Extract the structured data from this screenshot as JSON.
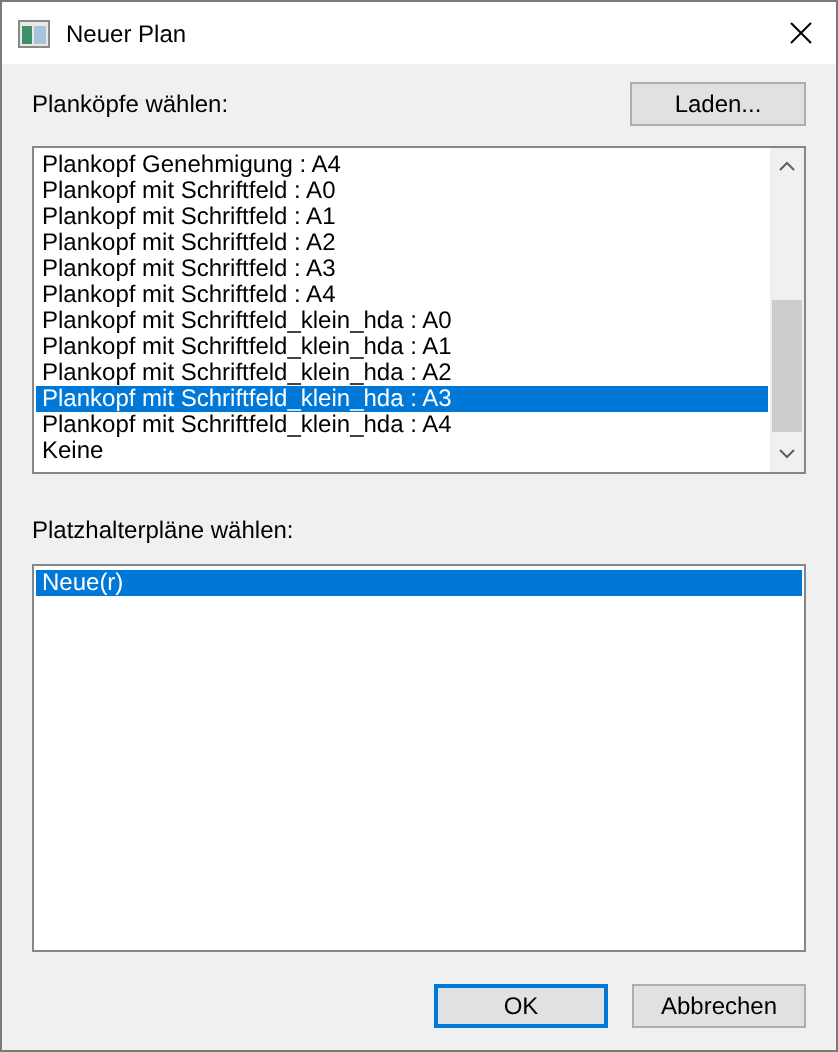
{
  "window": {
    "title": "Neuer Plan"
  },
  "plankoepfe": {
    "label": "Planköpfe wählen:",
    "load_button": "Laden...",
    "items": [
      {
        "text": "Plankopf Genehmigung : A4",
        "selected": false
      },
      {
        "text": "Plankopf mit Schriftfeld : A0",
        "selected": false
      },
      {
        "text": "Plankopf mit Schriftfeld : A1",
        "selected": false
      },
      {
        "text": "Plankopf mit Schriftfeld : A2",
        "selected": false
      },
      {
        "text": "Plankopf mit Schriftfeld : A3",
        "selected": false
      },
      {
        "text": "Plankopf mit Schriftfeld : A4",
        "selected": false
      },
      {
        "text": "Plankopf mit Schriftfeld_klein_hda : A0",
        "selected": false
      },
      {
        "text": "Plankopf mit Schriftfeld_klein_hda : A1",
        "selected": false
      },
      {
        "text": "Plankopf mit Schriftfeld_klein_hda : A2",
        "selected": false
      },
      {
        "text": "Plankopf mit Schriftfeld_klein_hda : A3",
        "selected": true
      },
      {
        "text": "Plankopf mit Schriftfeld_klein_hda : A4",
        "selected": false
      },
      {
        "text": "Keine",
        "selected": false
      }
    ]
  },
  "platzhalter": {
    "label": "Platzhalterpläne wählen:",
    "items": [
      {
        "text": "Neue(r)",
        "selected": true
      }
    ]
  },
  "buttons": [
    {
      "label": "OK",
      "default": true
    },
    {
      "label": "Abbrechen",
      "default": false
    }
  ]
}
